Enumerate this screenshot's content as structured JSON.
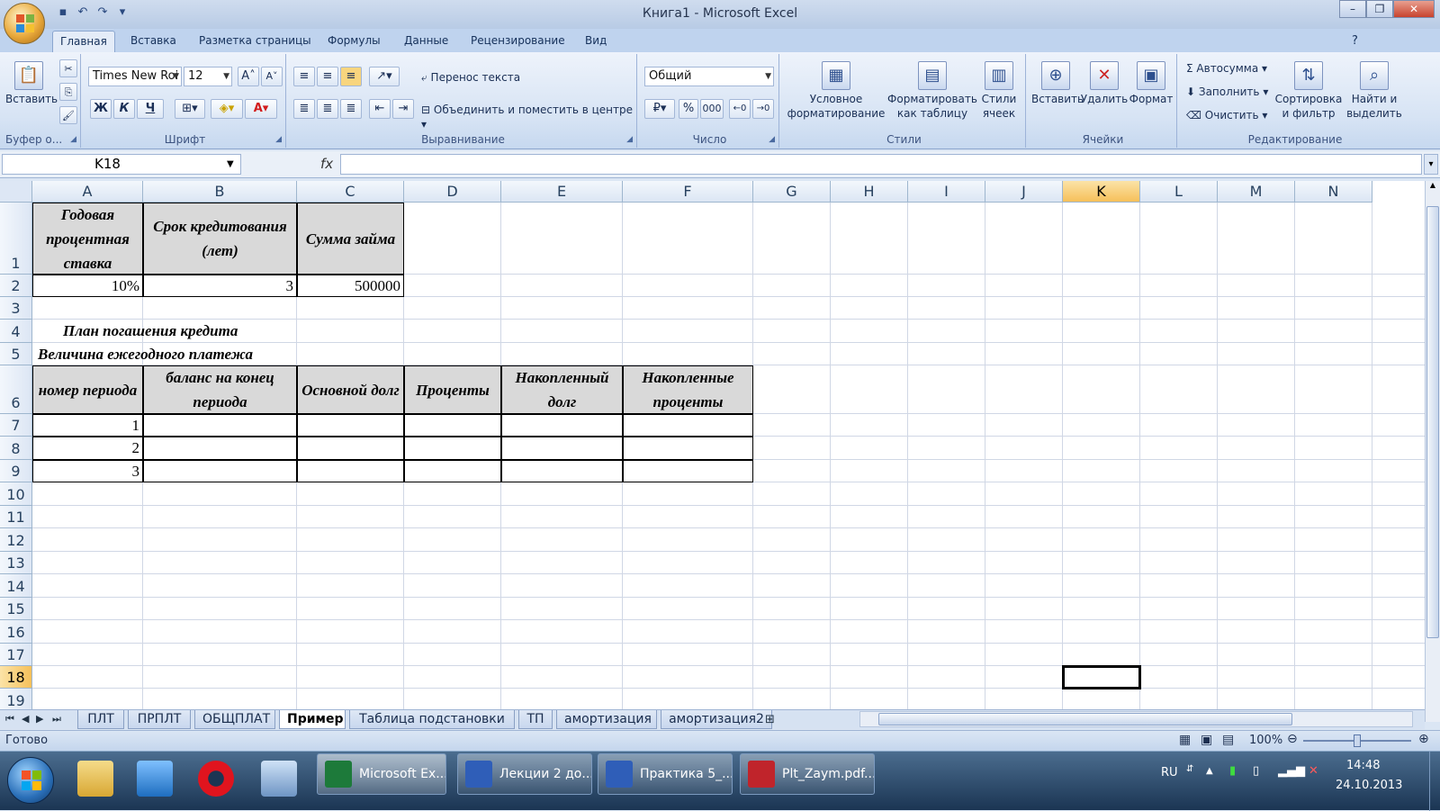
{
  "window": {
    "title": "Книга1 - Microsoft Excel"
  },
  "ribbon_tabs": [
    "Главная",
    "Вставка",
    "Разметка страницы",
    "Формулы",
    "Данные",
    "Рецензирование",
    "Вид"
  ],
  "ribbon": {
    "clipboard": {
      "paste": "Вставить",
      "label": "Буфер о..."
    },
    "font": {
      "name": "Times New Roi",
      "size": "12",
      "bold": "Ж",
      "italic": "К",
      "underline": "Ч",
      "label": "Шрифт"
    },
    "alignment": {
      "wrap": "Перенос текста",
      "merge": "Объединить и поместить в центре",
      "label": "Выравнивание"
    },
    "number": {
      "format": "Общий",
      "percent": "%",
      "thousands": "000",
      "label": "Число"
    },
    "styles": {
      "conditional1": "Условное",
      "conditional2": "форматирование",
      "table1": "Форматировать",
      "table2": "как таблицу",
      "cell1": "Стили",
      "cell2": "ячеек",
      "label": "Стили"
    },
    "cells": {
      "insert": "Вставить",
      "delete": "Удалить",
      "format": "Формат",
      "label": "Ячейки"
    },
    "editing": {
      "autosum": "Автосумма",
      "fill": "Заполнить",
      "clear": "Очистить",
      "sort1": "Сортировка",
      "sort2": "и фильтр",
      "find1": "Найти и",
      "find2": "выделить",
      "label": "Редактирование"
    }
  },
  "formula_bar": {
    "name_box": "K18",
    "fx": "fx",
    "formula": ""
  },
  "columns": [
    "A",
    "B",
    "C",
    "D",
    "E",
    "F",
    "G",
    "H",
    "I",
    "J",
    "K",
    "L",
    "M",
    "N"
  ],
  "selected_column": "K",
  "rows": [
    "1",
    "2",
    "3",
    "4",
    "5",
    "6",
    "7",
    "8",
    "9",
    "10",
    "11",
    "12",
    "13",
    "14",
    "15",
    "16",
    "17",
    "18",
    "19"
  ],
  "selected_row": "18",
  "cells": {
    "A1": "Годовая процентная ставка",
    "B1": "Срок кредитования (лет)",
    "C1": "Сумма займа",
    "A2": "10%",
    "B2": "3",
    "C2": "500000",
    "A4": "План погашения кредита",
    "A5": "Величина ежегодного платежа",
    "A6": "номер периода",
    "B6": "баланс на конец периода",
    "C6": "Основной долг",
    "D6": "Проценты",
    "E6": "Накопленный долг",
    "F6": "Накопленные проценты",
    "A7": "1",
    "A8": "2",
    "A9": "3"
  },
  "sheets": [
    "ПЛТ",
    "ПРПЛТ",
    "ОБЩПЛАТ",
    "Пример",
    "Таблица подстановки",
    "ТП",
    "амортизация",
    "амортизация2"
  ],
  "active_sheet": "Пример",
  "status": {
    "ready": "Готово",
    "zoom": "100%"
  },
  "taskbar": {
    "buttons": [
      "Microsoft Ex...",
      "Лекции 2 до...",
      "Практика 5_...",
      "Plt_Zaym.pdf..."
    ],
    "lang": "RU",
    "time": "14:48",
    "date": "24.10.2013"
  },
  "colors": {
    "header_fill": "#d9d9d9",
    "selected_header": "#f6c05a",
    "ribbon": "#d6e3f4"
  }
}
